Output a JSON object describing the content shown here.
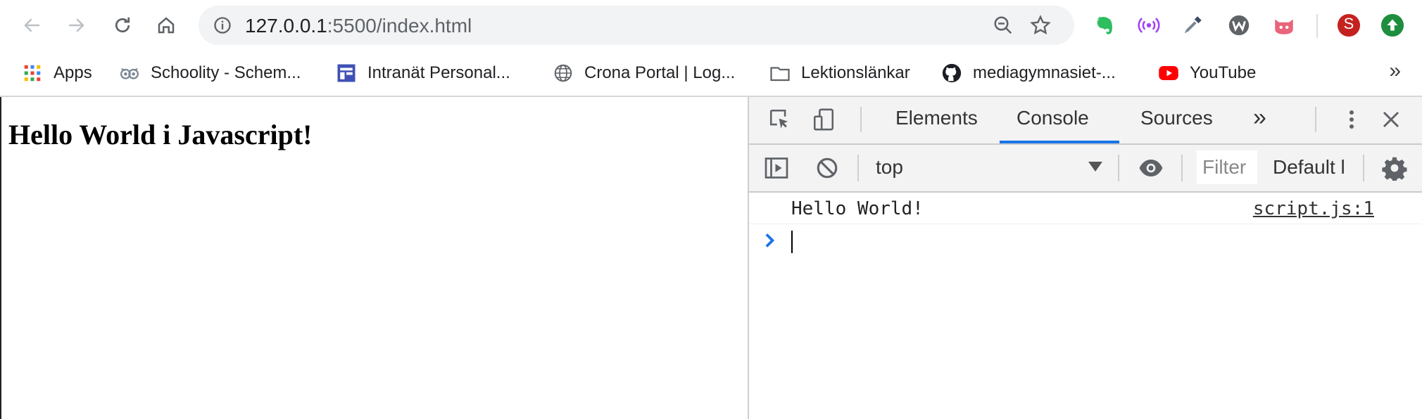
{
  "browser": {
    "url_host": "127.0.0.1",
    "url_rest": ":5500/index.html",
    "profile_initial": "S",
    "colors": {
      "profile": "#c5221f",
      "update": "#1e8e3e",
      "evernote": "#2dbe60",
      "podcast": "#a142f4",
      "pink": "#e8657a"
    }
  },
  "bookmarks": {
    "items": [
      {
        "label": "Apps",
        "icon": "apps-grid-icon"
      },
      {
        "label": "Schoolity - Schem...",
        "icon": "owl-icon"
      },
      {
        "label": "Intranät Personal...",
        "icon": "intranet-icon"
      },
      {
        "label": "Crona Portal | Log...",
        "icon": "globe-icon"
      },
      {
        "label": "Lektionslänkar",
        "icon": "folder-icon"
      },
      {
        "label": "mediagymnasiet-...",
        "icon": "github-icon"
      },
      {
        "label": "YouTube",
        "icon": "youtube-icon"
      }
    ],
    "more": "»"
  },
  "page": {
    "heading": "Hello World i Javascript!"
  },
  "devtools": {
    "tabs": [
      "Elements",
      "Console",
      "Sources"
    ],
    "active_tab": "Console",
    "more_tabs": "»",
    "context": "top",
    "filter_placeholder": "Filter",
    "levels": "Default l",
    "log": {
      "message": "Hello World!",
      "source": "script.js:1"
    },
    "accent": "#1a73e8"
  }
}
